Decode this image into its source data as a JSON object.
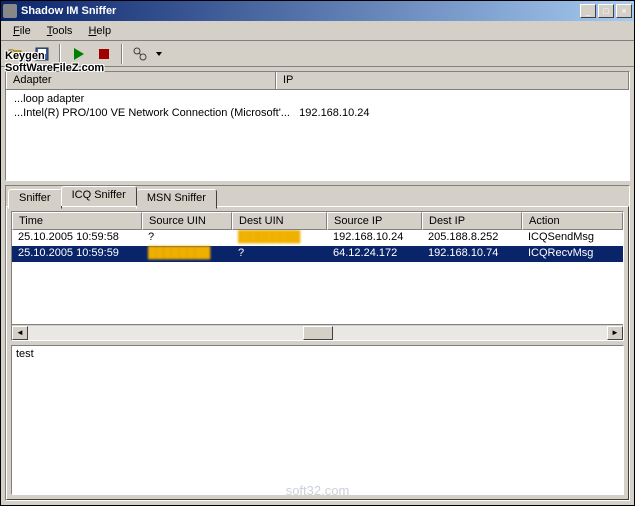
{
  "window": {
    "title": "Shadow IM Sniffer"
  },
  "menu": {
    "file": "File",
    "tools": "Tools",
    "help": "Help"
  },
  "adapter_panel": {
    "col_adapter": "Adapter",
    "col_ip": "IP",
    "rows": [
      {
        "adapter": "...loop adapter",
        "ip": ""
      },
      {
        "adapter": "...Intel(R) PRO/100 VE Network Connection (Microsoft'...",
        "ip": "192.168.10.24"
      }
    ]
  },
  "tabs": {
    "sniffer": "Sniffer",
    "icq": "ICQ Sniffer",
    "msn": "MSN Sniffer"
  },
  "grid": {
    "cols": {
      "time": "Time",
      "suin": "Source UIN",
      "duin": "Dest UIN",
      "sip": "Source IP",
      "dip": "Dest IP",
      "action": "Action"
    },
    "rows": [
      {
        "time": "25.10.2005 10:59:58",
        "suin": "?",
        "duin": "████████",
        "sip": "192.168.10.24",
        "dip": "205.188.8.252",
        "action": "ICQSendMsg",
        "selected": false
      },
      {
        "time": "25.10.2005 10:59:59",
        "suin": "████████",
        "duin": "?",
        "sip": "64.12.24.172",
        "dip": "192.168.10.74",
        "action": "ICQRecvMsg",
        "selected": true
      }
    ]
  },
  "detail": {
    "text": "test"
  },
  "watermark": {
    "line1": "Keygen",
    "line2": "SoftWareFileZ.com",
    "footer": "soft32.com"
  }
}
